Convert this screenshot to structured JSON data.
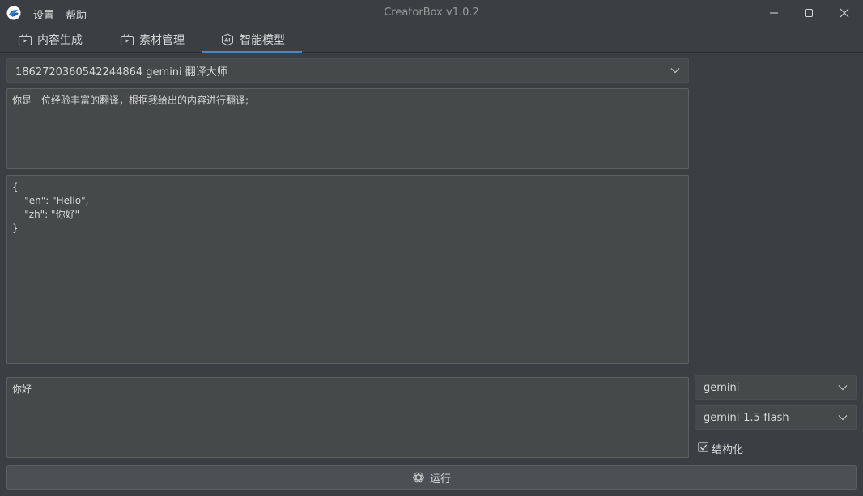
{
  "app": {
    "title": "CreatorBox v1.0.2",
    "menu": [
      "设置",
      "帮助"
    ]
  },
  "tabs": [
    {
      "label": "内容生成",
      "icon": "video-icon"
    },
    {
      "label": "素材管理",
      "icon": "video-icon"
    },
    {
      "label": "智能模型",
      "icon": "ai-icon",
      "active": true
    }
  ],
  "main": {
    "prompt_select": "1862720360542244864 gemini 翻译大师",
    "system_prompt": "你是一位经验丰富的翻译，根据我给出的内容进行翻译;",
    "output_json": "{\n    \"en\": \"Hello\",\n    \"zh\": \"你好\"\n}",
    "input_text": "你好"
  },
  "sidebar": {
    "provider": "gemini",
    "model": "gemini-1.5-flash",
    "structured_label": "结构化",
    "structured_checked": true
  },
  "run_button": {
    "label": "运行"
  },
  "colors": {
    "accent": "#4a88c7",
    "background": "#3c3f41",
    "field": "#45494a"
  }
}
